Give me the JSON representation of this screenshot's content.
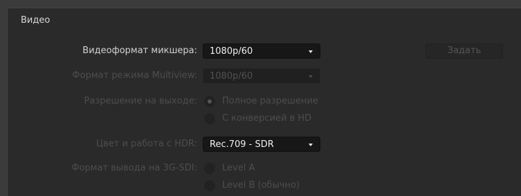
{
  "section": {
    "title": "Видео"
  },
  "mixer_format": {
    "label": "Видеоформат микшера:",
    "value": "1080p/60"
  },
  "set_button": {
    "label": "Задать"
  },
  "multiview_format": {
    "label": "Формат режима Multiview:",
    "value": "1080p/60"
  },
  "output_resolution": {
    "label": "Разрешение на выходе:",
    "options": [
      "Полное разрешение",
      "С конверсией в HD"
    ],
    "selected": "Полное разрешение"
  },
  "hdr": {
    "label": "Цвет и работа с HDR:",
    "value": "Rec.709 - SDR"
  },
  "sdi_output": {
    "label": "Формат вывода на 3G-SDI:",
    "options": [
      "Level A",
      "Level B (обычно)"
    ]
  }
}
